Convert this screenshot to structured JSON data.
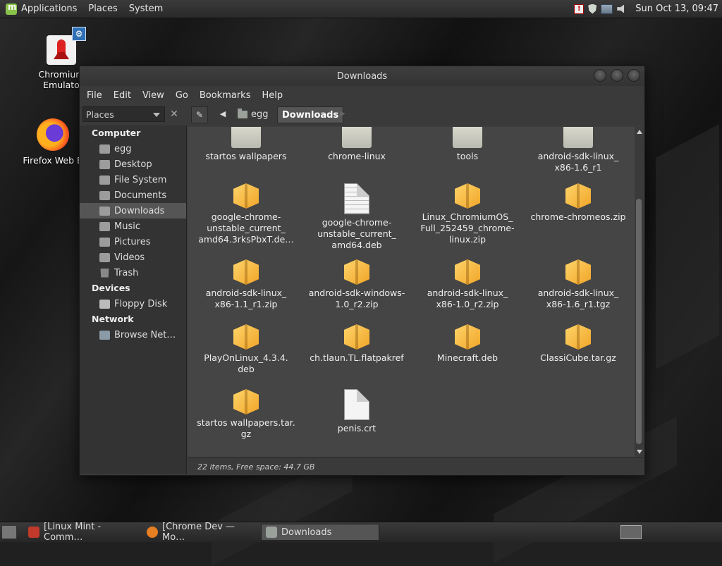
{
  "top_panel": {
    "menus": [
      "Applications",
      "Places",
      "System"
    ],
    "clock": "Sun Oct 13, 09:47",
    "tray_icons": [
      "alert-icon",
      "shield-icon",
      "network-icon",
      "volume-icon"
    ],
    "alert_glyph": "!"
  },
  "desktop": {
    "icons": [
      {
        "label_line1": "Chromium",
        "label_line2": "Emulato",
        "icon": "rocket-icon"
      },
      {
        "label_line1": "Firefox Web B",
        "icon": "firefox-icon"
      }
    ],
    "gear_glyph": "⚙"
  },
  "window": {
    "title": "Downloads",
    "menu": [
      "File",
      "Edit",
      "View",
      "Go",
      "Bookmarks",
      "Help"
    ],
    "toolbar": {
      "places_label": "Places",
      "close_glyph": "✕",
      "edit_glyph": "✎",
      "back_glyph": "◀",
      "forward_glyph": "▶",
      "breadcrumbs": [
        "egg",
        "Downloads"
      ]
    },
    "sidebar": {
      "sections": [
        {
          "title": "Computer",
          "items": [
            "egg",
            "Desktop",
            "File System",
            "Documents",
            "Downloads",
            "Music",
            "Pictures",
            "Videos",
            "Trash"
          ]
        },
        {
          "title": "Devices",
          "items": [
            "Floppy Disk"
          ]
        },
        {
          "title": "Network",
          "items": [
            "Browse Net…"
          ]
        }
      ],
      "selected": "Downloads"
    },
    "files": [
      {
        "name": "startos wallpapers",
        "type": "folder"
      },
      {
        "name": "chrome-linux",
        "type": "folder"
      },
      {
        "name": "tools",
        "type": "folder"
      },
      {
        "name": "android-sdk-linux_ x86-1.6_r1",
        "type": "folder"
      },
      {
        "name": "google-chrome-unstable_current_ amd64.3rksPbxT.de…",
        "type": "package"
      },
      {
        "name": "google-chrome-unstable_current_ amd64.deb",
        "type": "document"
      },
      {
        "name": "Linux_ChromiumOS_ Full_252459_chrome-linux.zip",
        "type": "package"
      },
      {
        "name": "chrome-chromeos.zip",
        "type": "package"
      },
      {
        "name": "android-sdk-linux_ x86-1.1_r1.zip",
        "type": "package"
      },
      {
        "name": "android-sdk-windows-1.0_r2.zip",
        "type": "package"
      },
      {
        "name": "android-sdk-linux_ x86-1.0_r2.zip",
        "type": "package"
      },
      {
        "name": "android-sdk-linux_ x86-1.6_r1.tgz",
        "type": "package"
      },
      {
        "name": "PlayOnLinux_4.3.4. deb",
        "type": "package"
      },
      {
        "name": "ch.tlaun.TL.flatpakref",
        "type": "package"
      },
      {
        "name": "Minecraft.deb",
        "type": "package"
      },
      {
        "name": "ClassiCube.tar.gz",
        "type": "package"
      },
      {
        "name": "startos wallpapers.tar. gz",
        "type": "package"
      },
      {
        "name": "penis.crt",
        "type": "blank"
      }
    ],
    "status": "22 items, Free space: 44.7 GB"
  },
  "taskbar": {
    "tasks": [
      {
        "label": "[Linux Mint - Comm…",
        "active": false,
        "color": "#c0392b"
      },
      {
        "label": "[Chrome Dev — Mo…",
        "active": false,
        "color": "#e67e22"
      },
      {
        "label": "Downloads",
        "active": true,
        "color": "#9aa09a"
      }
    ]
  }
}
